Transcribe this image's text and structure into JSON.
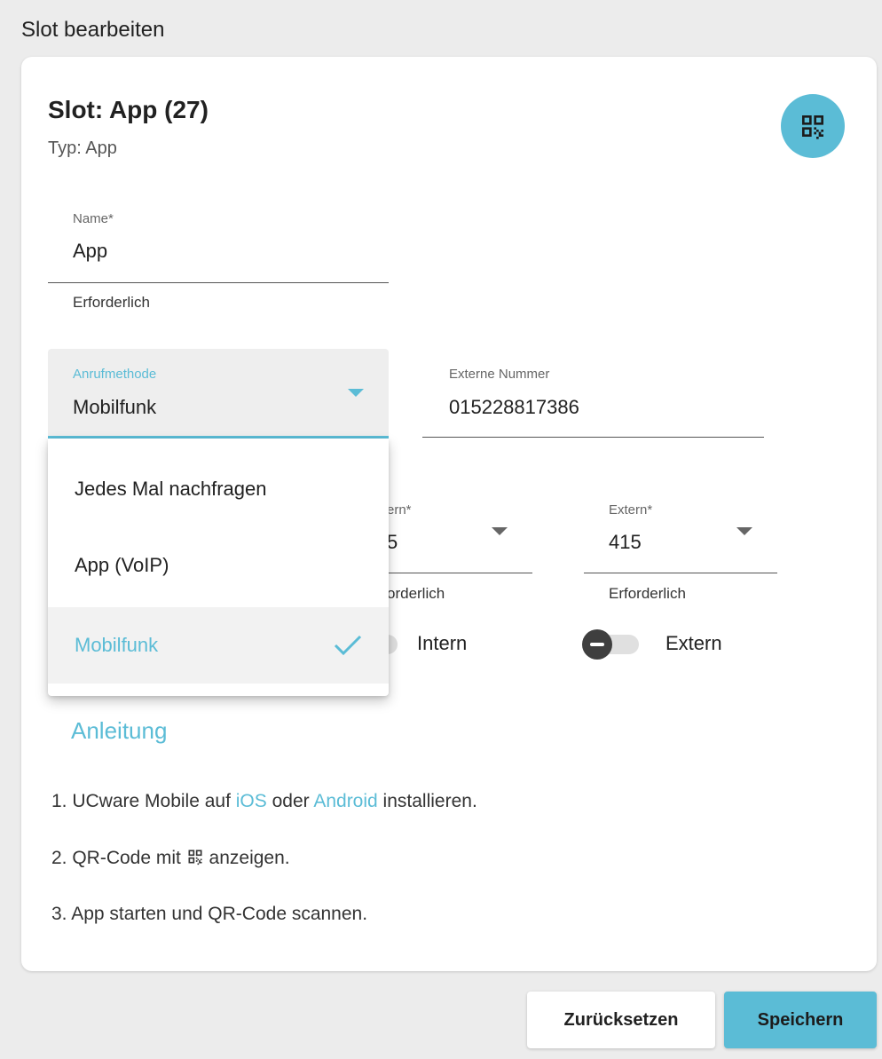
{
  "page": {
    "title": "Slot bearbeiten"
  },
  "slot": {
    "title": "Slot: App (27)",
    "type": "Typ: App"
  },
  "name_field": {
    "label": "Name*",
    "value": "App",
    "helper": "Erforderlich"
  },
  "call_method": {
    "label": "Anrufmethode",
    "value": "Mobilfunk",
    "options": [
      {
        "label": "Jedes Mal nachfragen"
      },
      {
        "label": "App (VoIP)"
      },
      {
        "label": "Mobilfunk"
      }
    ]
  },
  "external_number": {
    "label": "Externe Nummer",
    "value": "015228817386"
  },
  "intern_select": {
    "label_partial": "ern*",
    "value_partial": "5",
    "helper_partial": "orderlich"
  },
  "extern_select": {
    "label": "Extern*",
    "value": "415",
    "helper": "Erforderlich"
  },
  "toggles": {
    "intern_label": "Intern",
    "extern_label": "Extern"
  },
  "instructions": {
    "title": "Anleitung",
    "step1_prefix": "1. UCware Mobile auf ",
    "step1_ios": "iOS",
    "step1_mid": " oder ",
    "step1_android": "Android",
    "step1_suffix": " installieren.",
    "step2_prefix": "2. QR-Code mit ",
    "step2_suffix": " anzeigen.",
    "step3": "3. App starten und QR-Code scannen."
  },
  "buttons": {
    "reset": "Zurücksetzen",
    "save": "Speichern"
  },
  "colors": {
    "accent": "#5bbcd6",
    "background": "#ececec",
    "card": "#ffffff"
  }
}
